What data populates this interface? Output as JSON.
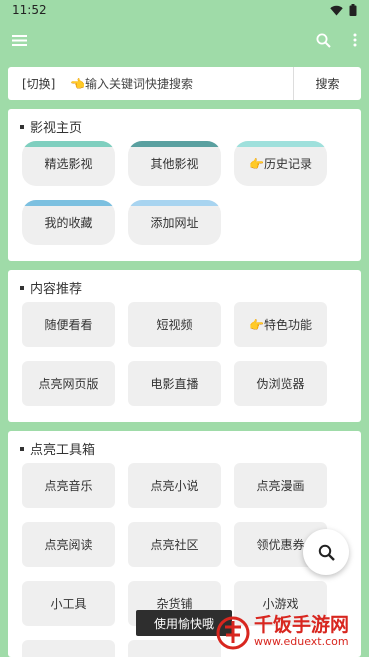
{
  "status": {
    "time": "11:52"
  },
  "search": {
    "switch_label": "[切换]",
    "placeholder": "👈输入关键词快捷搜索",
    "button": "搜索"
  },
  "sections": [
    {
      "title": "影视主页",
      "items": [
        {
          "label": "精选影视",
          "accent": "#7fcfbf"
        },
        {
          "label": "其他影视",
          "accent": "#5aa0a0"
        },
        {
          "label": "👉历史记录",
          "accent": "#9fe0dc"
        },
        {
          "label": "我的收藏",
          "accent": "#7cc0e0"
        },
        {
          "label": "添加网址",
          "accent": "#a8d4f0"
        }
      ]
    },
    {
      "title": "内容推荐",
      "items": [
        {
          "label": "随便看看"
        },
        {
          "label": "短视频"
        },
        {
          "label": "👉特色功能"
        },
        {
          "label": "点亮网页版"
        },
        {
          "label": "电影直播"
        },
        {
          "label": "伪浏览器"
        }
      ]
    },
    {
      "title": "点亮工具箱",
      "items": [
        {
          "label": "点亮音乐"
        },
        {
          "label": "点亮小说"
        },
        {
          "label": "点亮漫画"
        },
        {
          "label": "点亮阅读"
        },
        {
          "label": "点亮社区"
        },
        {
          "label": "领优惠券"
        },
        {
          "label": "小工具"
        },
        {
          "label": "杂货铺"
        },
        {
          "label": "小游戏"
        }
      ]
    }
  ],
  "toast": "使用愉快哦",
  "watermark": {
    "name": "千饭手游网",
    "url": "www.eduext.com"
  },
  "colors": {
    "background": "#9fdba8",
    "accent_red": "#d8261f"
  }
}
